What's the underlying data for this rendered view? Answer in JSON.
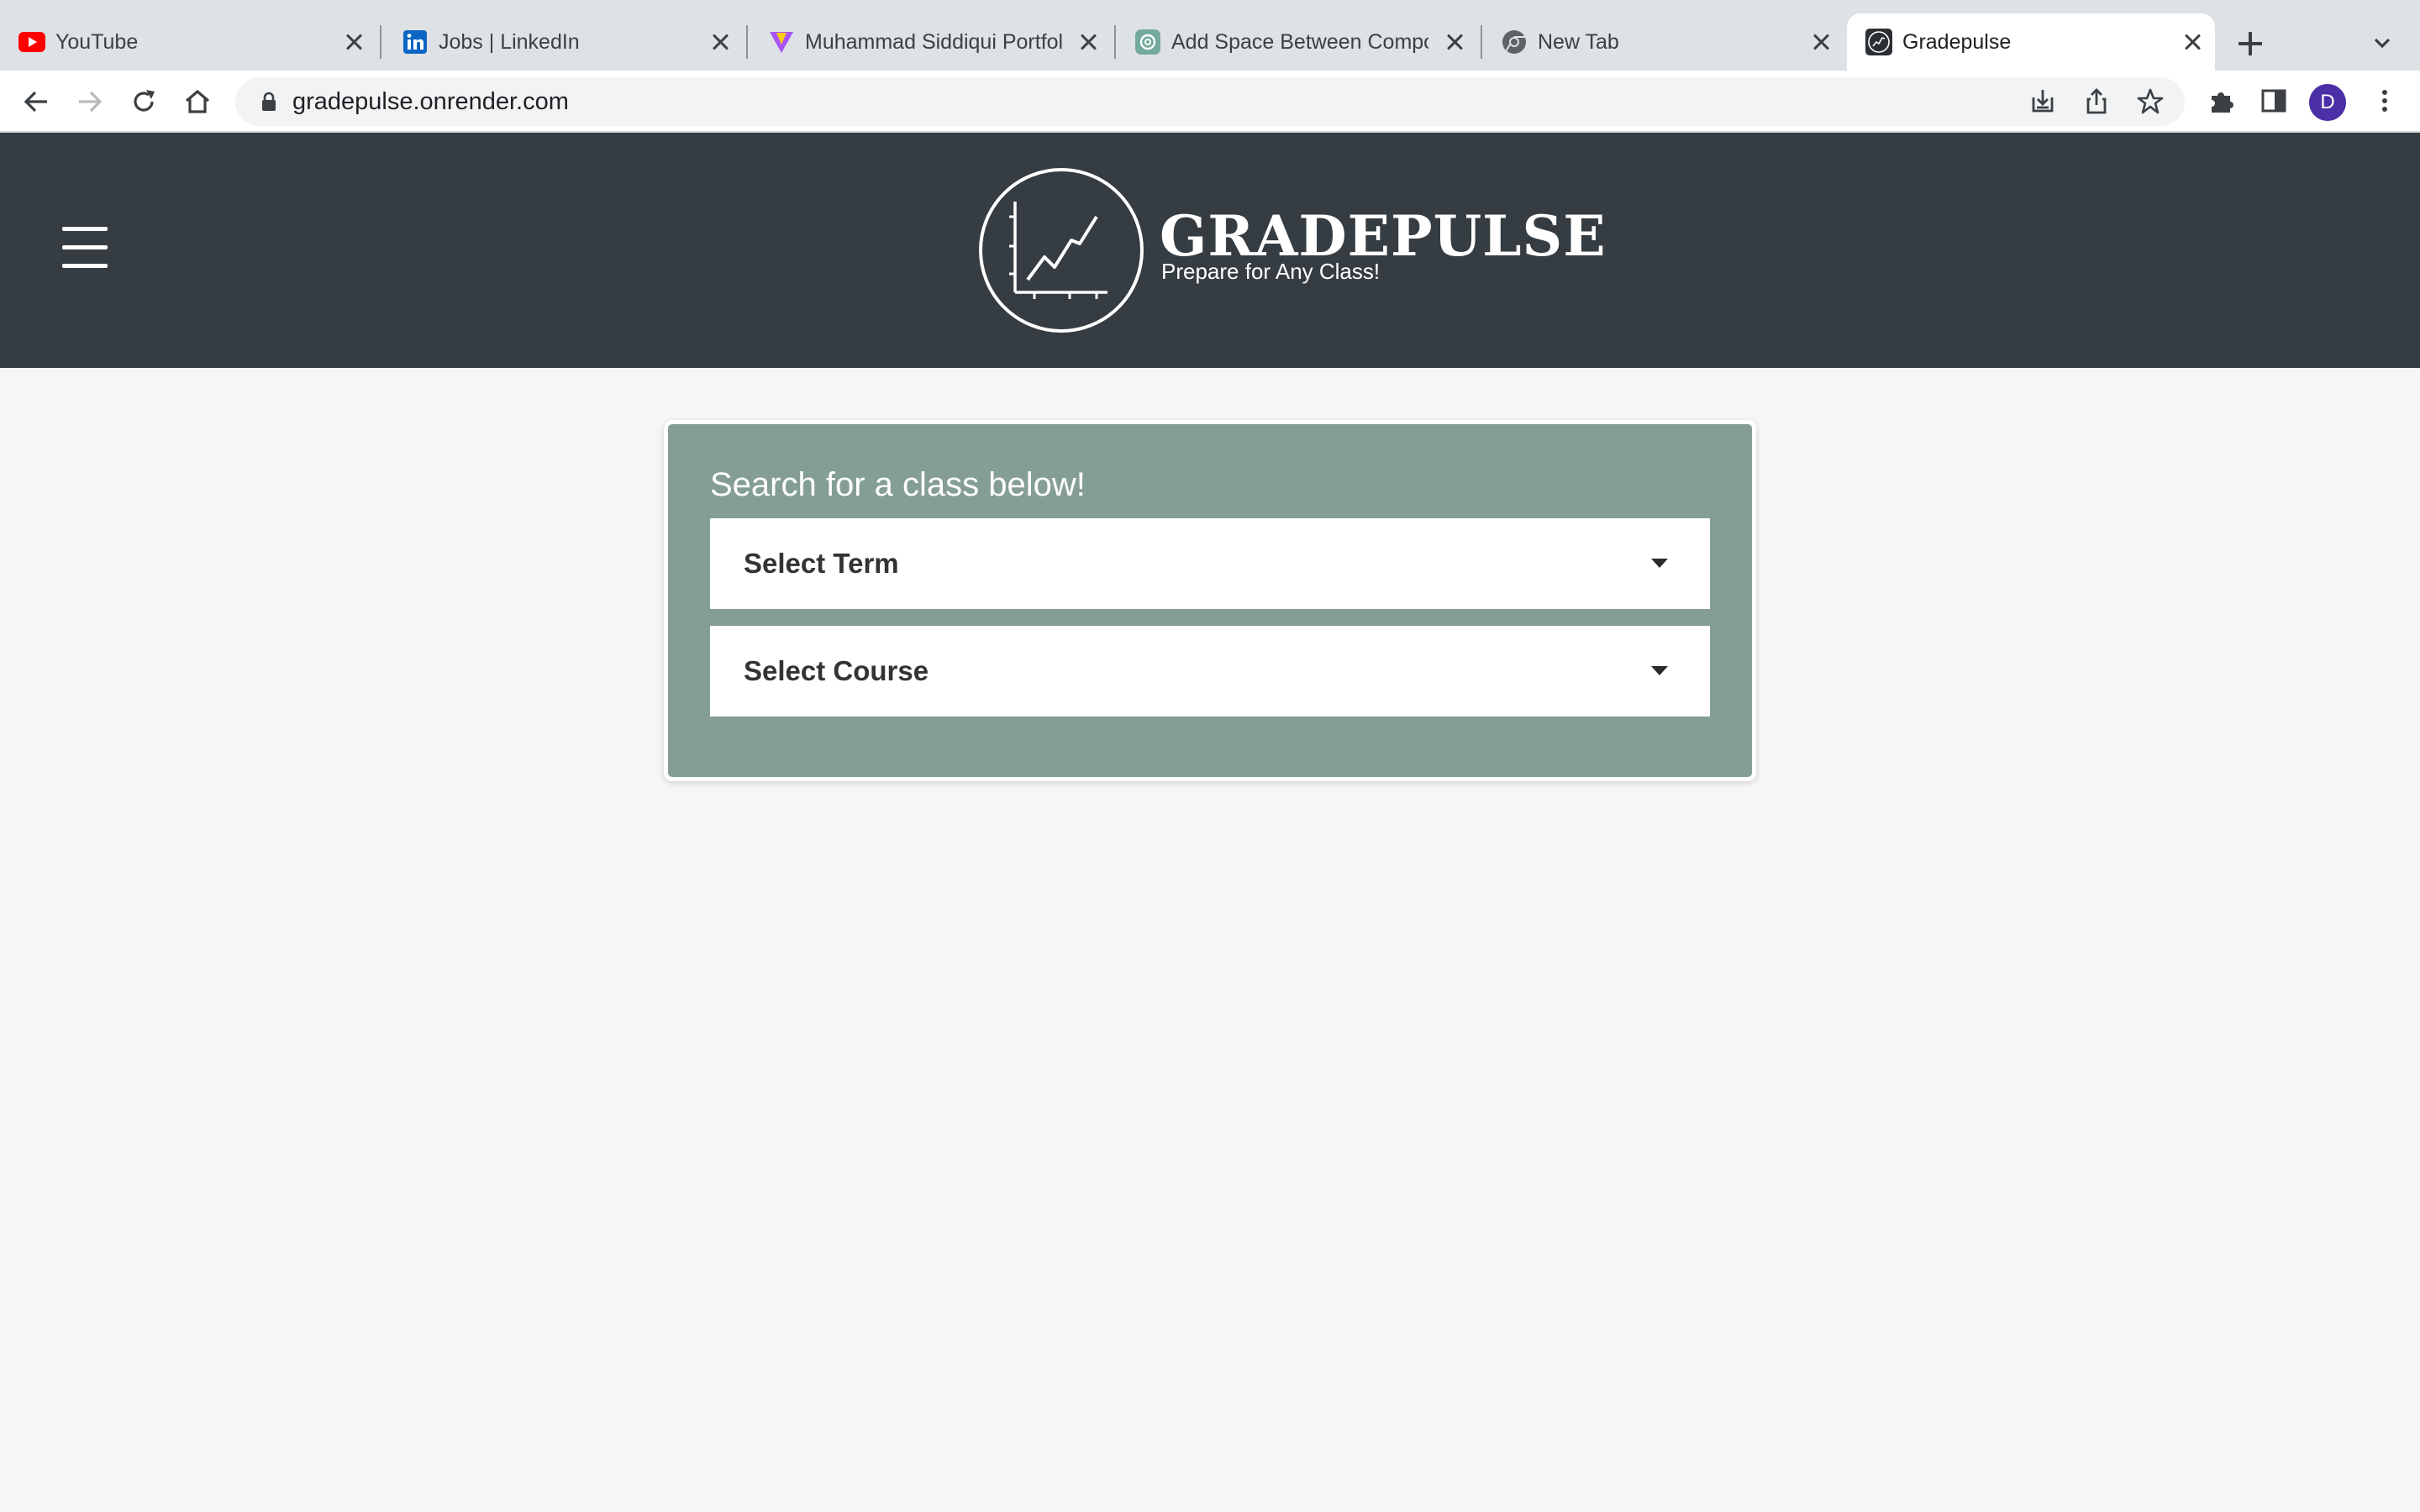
{
  "browser": {
    "tabs": [
      {
        "title": "YouTube",
        "icon": "youtube-icon"
      },
      {
        "title": "Jobs | LinkedIn",
        "icon": "linkedin-icon"
      },
      {
        "title": "Muhammad Siddiqui Portfolio",
        "icon": "vite-icon"
      },
      {
        "title": "Add Space Between Components",
        "icon": "chatgpt-icon"
      },
      {
        "title": "New Tab",
        "icon": "chrome-icon"
      },
      {
        "title": "Gradepulse",
        "icon": "gradepulse-icon",
        "active": true
      }
    ],
    "url": "gradepulse.onrender.com",
    "profile_initial": "D",
    "profile_color": "#4a2fa6"
  },
  "header": {
    "brand": "GRADEPULSE",
    "tagline": "Prepare for Any Class!",
    "background": "#363d42"
  },
  "search": {
    "title": "Search for a class below!",
    "term_select": {
      "value": "Select Term"
    },
    "course_select": {
      "value": "Select Course"
    },
    "card_color": "#849d97"
  }
}
